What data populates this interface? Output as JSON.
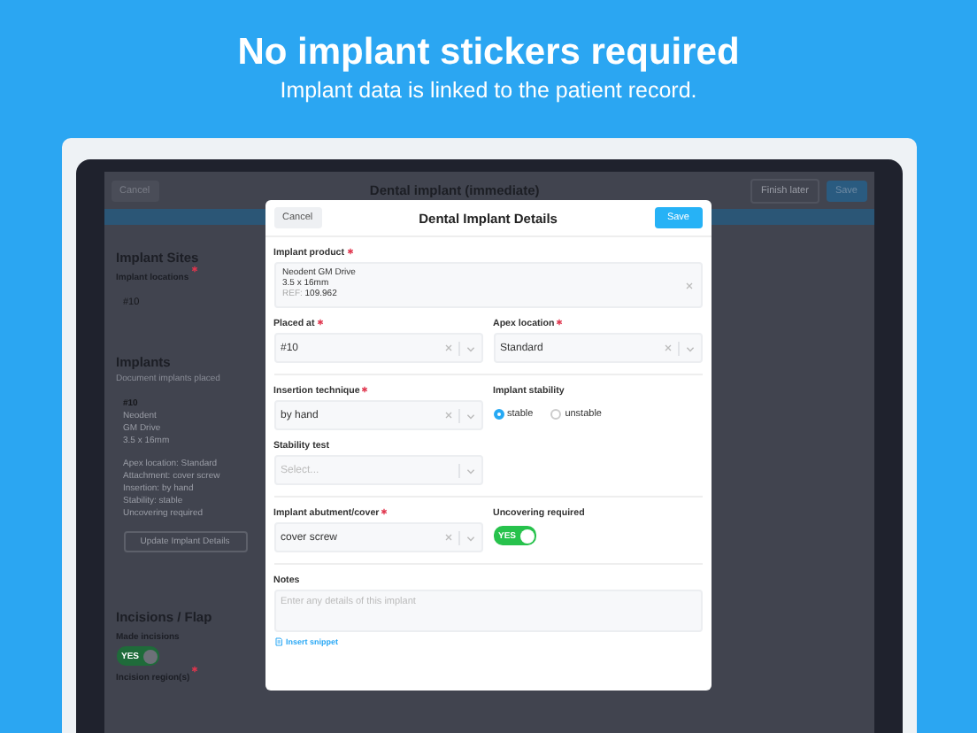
{
  "header": {
    "title": "No implant stickers required",
    "subtitle": "Implant data is linked to the patient record."
  },
  "app": {
    "cancel": "Cancel",
    "title": "Dental implant (immediate)",
    "finish_later": "Finish later",
    "save": "Save",
    "sites": {
      "heading": "Implant Sites",
      "label": "Implant locations",
      "required": true,
      "value": "#10"
    },
    "implants": {
      "heading": "Implants",
      "hint": "Document implants placed",
      "card": {
        "site": "#10",
        "lines": [
          "Neodent",
          "GM Drive",
          "3.5 x 16mm"
        ],
        "details": [
          "Apex location: Standard",
          "Attachment: cover screw",
          "Insertion: by hand",
          "Stability: stable",
          "Uncovering required"
        ],
        "button": "Update Implant Details"
      }
    },
    "incisions": {
      "heading": "Incisions / Flap",
      "toggle_label": "Made incisions",
      "on": true,
      "toggle_text": "YES",
      "next_label": "Incision region(s)",
      "next_required": true
    }
  },
  "modal": {
    "cancel": "Cancel",
    "title": "Dental Implant Details",
    "save": "Save",
    "product": {
      "label": "Implant product",
      "required": true,
      "lines": [
        "Neodent GM Drive",
        "3.5 x 16mm"
      ],
      "ref_label": "REF:",
      "ref": "109.962"
    },
    "placed_at": {
      "label": "Placed at",
      "required": true,
      "value": "#10"
    },
    "apex": {
      "label": "Apex location",
      "required": true,
      "value": "Standard"
    },
    "technique": {
      "label": "Insertion technique",
      "required": true,
      "value": "by hand"
    },
    "stability": {
      "label": "Implant stability",
      "options": [
        {
          "label": "stable",
          "selected": true
        },
        {
          "label": "unstable",
          "selected": false
        }
      ]
    },
    "stability_test": {
      "label": "Stability test",
      "placeholder": "Select..."
    },
    "abutment": {
      "label": "Implant abutment/cover",
      "required": true,
      "value": "cover screw"
    },
    "uncovering": {
      "label": "Uncovering required",
      "on": true,
      "toggle_text": "YES"
    },
    "notes": {
      "label": "Notes",
      "placeholder": "Enter any details of this implant"
    },
    "snippet": "Insert snippet"
  }
}
